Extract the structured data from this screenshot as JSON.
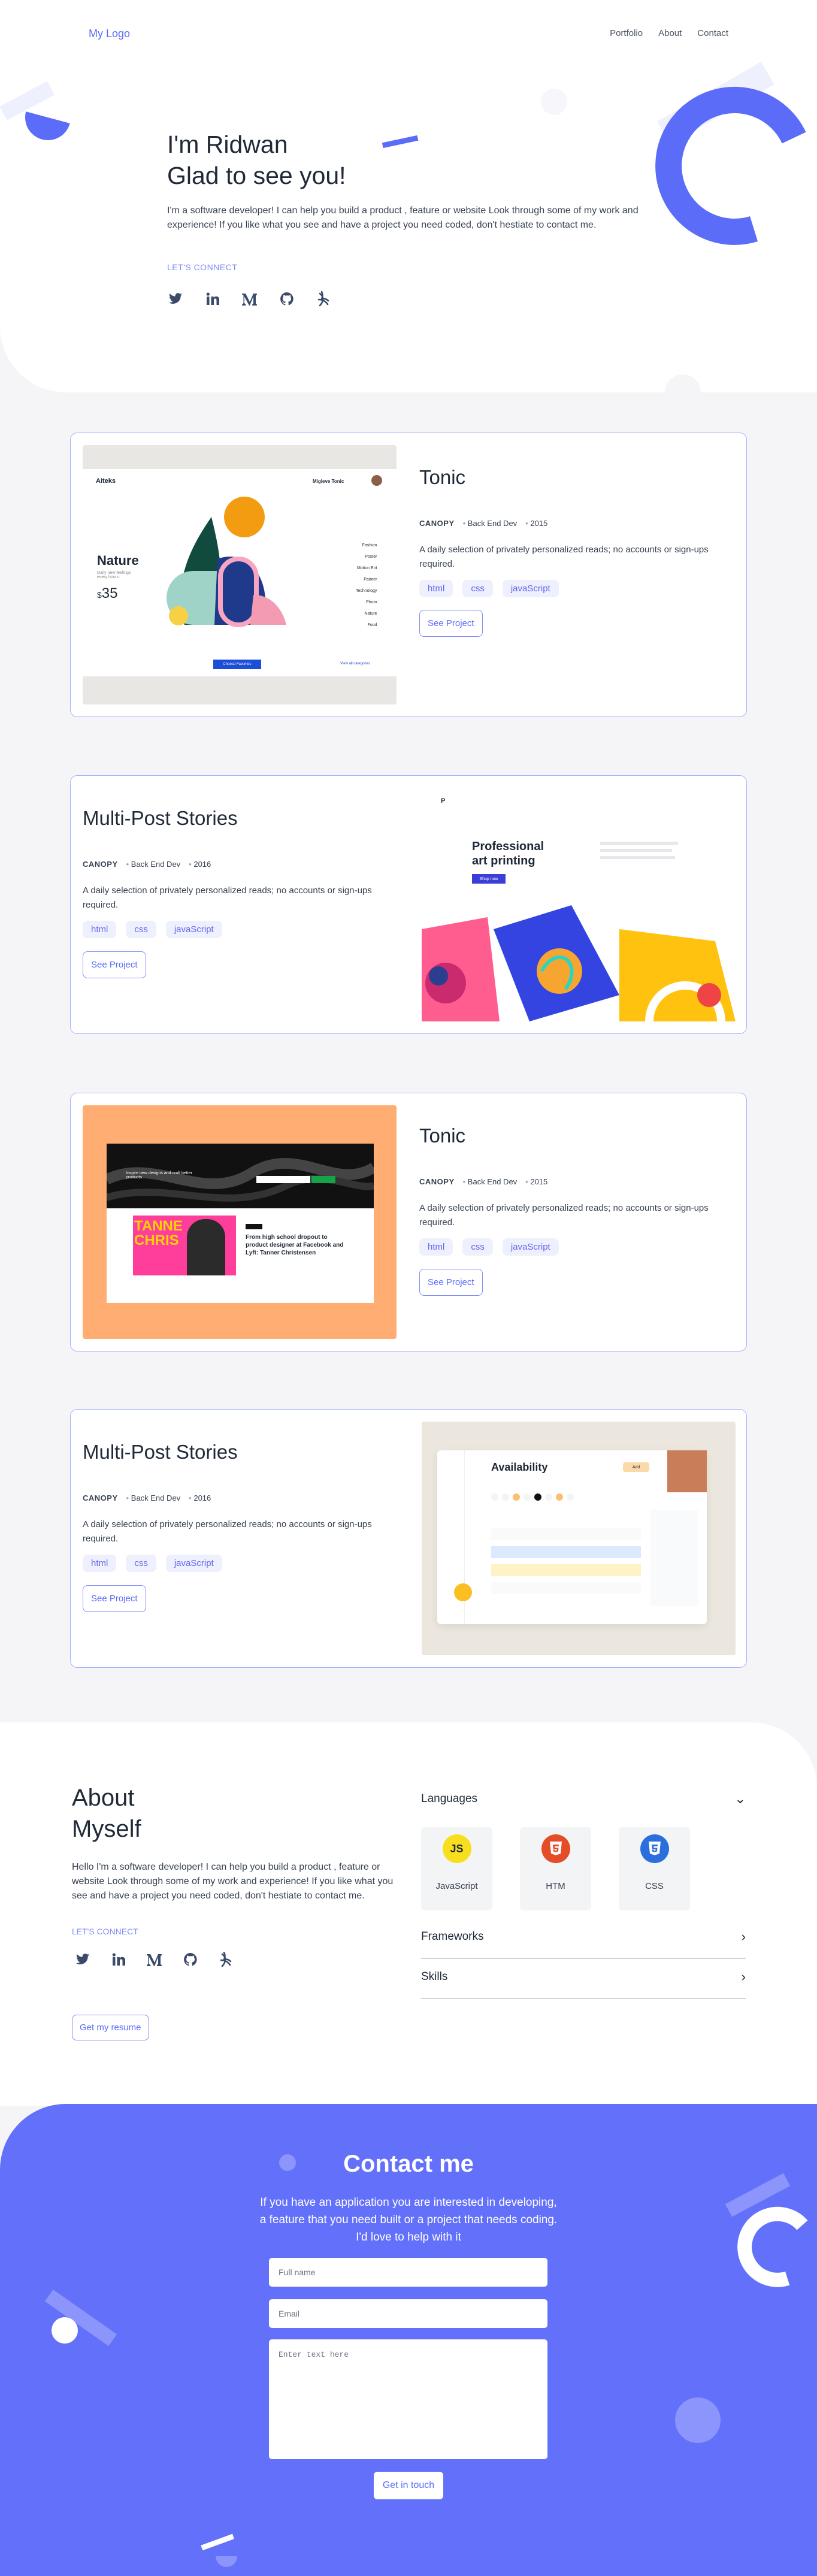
{
  "nav": {
    "logo": "My Logo",
    "links": [
      "Portfolio",
      "About",
      "Contact"
    ]
  },
  "hero": {
    "title_line1": "I'm Ridwan",
    "title_line2": "Glad to see you!",
    "description": "I'm a software developer! I can help you build a product , feature or website Look through some of my work and experience! If you like what you see and have a project you need coded, don't hestiate to contact me.",
    "connect_label": "LET'S CONNECT"
  },
  "socials": [
    "twitter-icon",
    "linkedin-icon",
    "medium-icon",
    "github-icon",
    "dribbble-icon"
  ],
  "projects": [
    {
      "title": "Tonic",
      "category": "CANOPY",
      "role": "Back End Dev",
      "year": "2015",
      "description": "A daily selection of privately personalized reads; no accounts or sign-ups required.",
      "tags": [
        "html",
        "css",
        "javaScript"
      ],
      "button": "See Project",
      "mock": {
        "brand": "Aiteks",
        "user": "Migleve Tonic",
        "product": "Nature",
        "subtitle": "Daily new feelings every hours",
        "price": "35",
        "currency": "$",
        "menu": [
          "Fashion",
          "Poster",
          "Motion Ent",
          "Painter",
          "Technology",
          "Photo",
          "Nature",
          "Food"
        ],
        "cta": "Choose Favorites",
        "link": "View all categories"
      }
    },
    {
      "title": "Multi-Post Stories",
      "category": "CANOPY",
      "role": "Back End Dev",
      "year": "2016",
      "description": "A daily selection of privately personalized reads; no accounts or sign-ups required.",
      "tags": [
        "html",
        "css",
        "javaScript"
      ],
      "button": "See Project",
      "mock": {
        "logo": "P",
        "headline": "Professional art printing",
        "cta": "Shop now"
      }
    },
    {
      "title": "Tonic",
      "category": "CANOPY",
      "role": "Back End Dev",
      "year": "2015",
      "description": "A daily selection of privately personalized reads; no accounts or sign-ups required.",
      "tags": [
        "html",
        "css",
        "javaScript"
      ],
      "button": "See Project",
      "mock": {
        "hero_text": "Inspire new designs and craft better products",
        "headline": "From high school dropout to product designer at Facebook and Lyft: Tanner Christensen",
        "overlay": "TANNE CHRIS"
      }
    },
    {
      "title": "Multi-Post Stories",
      "category": "CANOPY",
      "role": "Back End Dev",
      "year": "2016",
      "description": "A daily selection of privately personalized reads; no accounts or sign-ups required.",
      "tags": [
        "html",
        "css",
        "javaScript"
      ],
      "button": "See Project",
      "mock": {
        "heading": "Availability",
        "button": "Add"
      }
    }
  ],
  "about": {
    "title_line1": "About",
    "title_line2": "Myself",
    "description": "Hello I'm a software developer! I can help you build a product , feature or website Look through some of my work and experience! If you like what you see and have a project you need coded, don't hestiate to contact me.",
    "connect_label": "LET'S CONNECT",
    "resume_button": "Get my resume",
    "accordion": {
      "languages": "Languages",
      "frameworks": "Frameworks",
      "skills": "Skills"
    },
    "languages": [
      {
        "name": "JavaScript",
        "badge": "JS",
        "color": "#f7df1e",
        "text": "#1f2937"
      },
      {
        "name": "HTM",
        "badge": "5",
        "color": "#e44d26",
        "text": "#ffffff"
      },
      {
        "name": "CSS",
        "badge": "3",
        "color": "#2a6fdb",
        "text": "#ffffff"
      }
    ]
  },
  "contact": {
    "title": "Contact me",
    "description": "If you have an application you are interested in developing, a feature that you need built or a project that needs coding. I'd love to help with it",
    "fullname_placeholder": "Full name",
    "email_placeholder": "Email",
    "message_placeholder": "Enter text here",
    "submit": "Get in touch"
  },
  "colors": {
    "accent": "#5b6cf9",
    "contact_bg": "#6370fa",
    "tag_bg": "#eef0fd"
  }
}
